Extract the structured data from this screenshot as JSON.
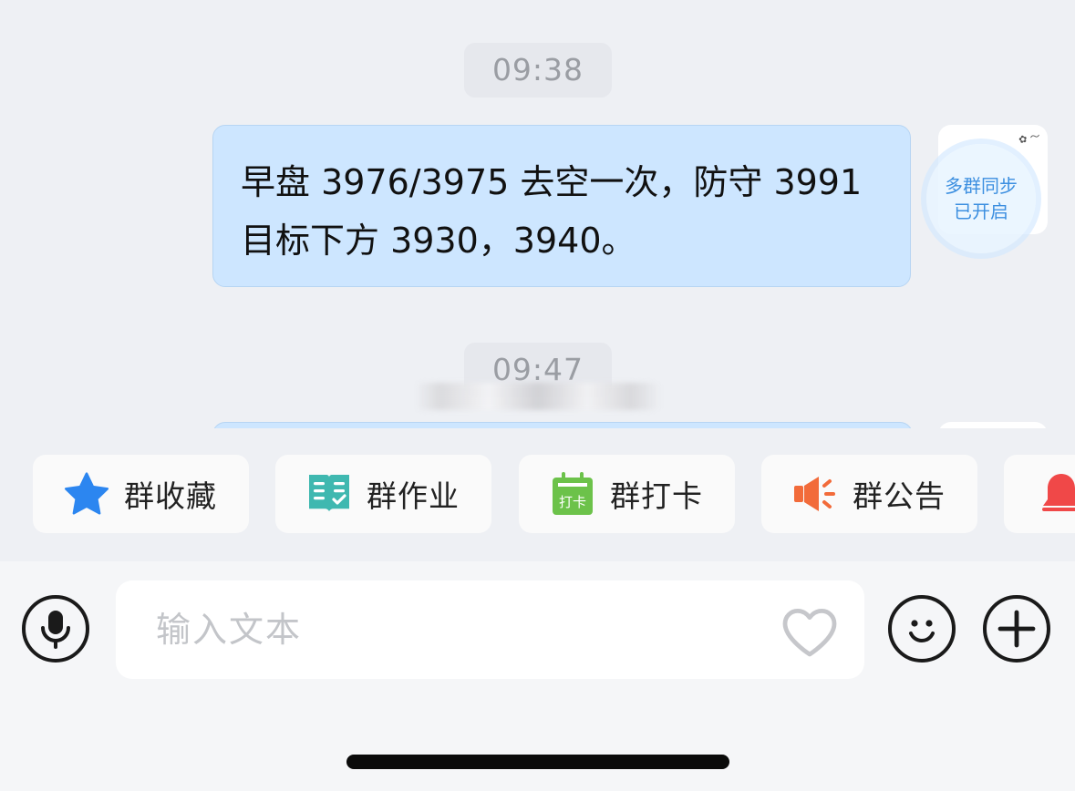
{
  "chat": {
    "timestamps": [
      "09:38",
      "09:47"
    ],
    "messages": [
      {
        "text": "早盘 3976/3975 去空一次，防守 3991目标下方 3930，3940。"
      }
    ],
    "sync_badge": {
      "line1": "多群同步",
      "line2": "已开启"
    }
  },
  "quick_actions": [
    {
      "label": "群收藏",
      "icon": "star-icon",
      "color": "#2c86f0"
    },
    {
      "label": "群作业",
      "icon": "homework-book-icon",
      "color": "#3fb8b0"
    },
    {
      "label": "群打卡",
      "icon": "checkin-calendar-icon",
      "color": "#6cc24a",
      "icon_text": "打卡"
    },
    {
      "label": "群公告",
      "icon": "megaphone-icon",
      "color": "#f26b3a"
    },
    {
      "label": "",
      "icon": "bell-icon",
      "color": "#f04848"
    }
  ],
  "input": {
    "placeholder": "输入文本"
  }
}
